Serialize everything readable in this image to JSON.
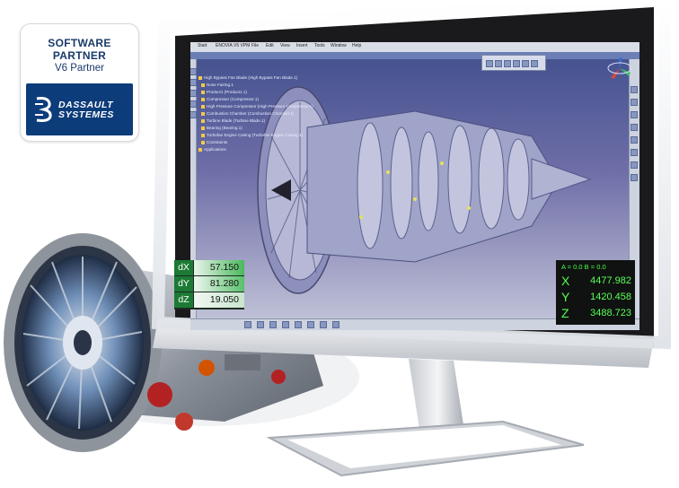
{
  "badge": {
    "line1": "SOFTWARE",
    "line2": "PARTNER",
    "line3": "V6 Partner",
    "brand": "DASSAULT\nSYSTEMES",
    "logo_icon": "3ds-logo-icon"
  },
  "catia": {
    "menu": [
      "Start",
      "ENOVIA V5 VPM",
      "File",
      "Edit",
      "View",
      "Insert",
      "Tools",
      "Window",
      "Help"
    ],
    "tree": [
      "High Bypass Fan Blade (High Bypass Fan Blade.1)",
      "Nose Fairing.1",
      "Product1 (Product1.1)",
      "Compressor (Compressor.1)",
      "High Pressure Compressor (High Pressure Compressor.1)",
      "Combustion Chamber (Combustion Chamber.1)",
      "Turbine Blade (Turbine Blade.1)",
      "Bearing (Bearing.1)",
      "Turbofan Engine Casing (Turbofan Engine Casing.1)",
      "Constraints",
      "Applications"
    ],
    "colors": {
      "background_top": "#3f4f8c",
      "background_bottom": "#c5c7da",
      "model": "#9fa4c8"
    }
  },
  "deltas": [
    {
      "label": "dX",
      "value": "57.150"
    },
    {
      "label": "dY",
      "value": "81.280"
    },
    {
      "label": "dZ",
      "value": "19.050"
    }
  ],
  "coords": {
    "header": "A = 0.0   B = 0.0",
    "rows": [
      {
        "label": "X",
        "value": "4477.982"
      },
      {
        "label": "Y",
        "value": "1420.458"
      },
      {
        "label": "Z",
        "value": "3488.723"
      }
    ]
  }
}
